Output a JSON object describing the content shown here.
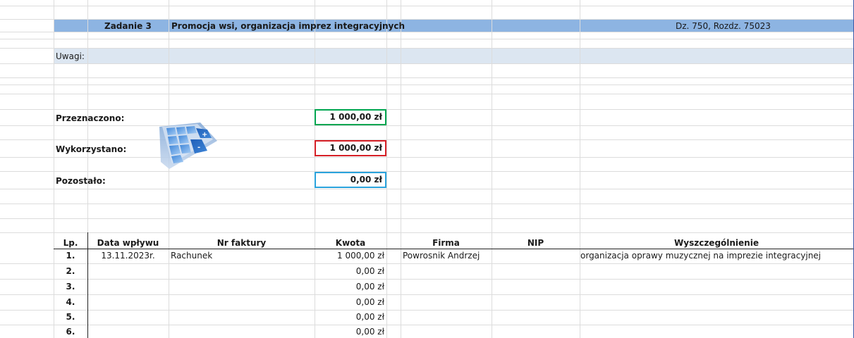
{
  "header": {
    "task_label": "Zadanie 3",
    "task_title": "Promocja wsi, organizacja imprez integracyjnych",
    "budget_code": "Dz. 750, Rozdz. 75023"
  },
  "notes": {
    "label": "Uwagi:"
  },
  "summary": {
    "allocated_label": "Przeznaczono:",
    "allocated_value": "1 000,00 zł",
    "used_label": "Wykorzystano:",
    "used_value": "1 000,00 zł",
    "remaining_label": "Pozostało:",
    "remaining_value": "0,00 zł"
  },
  "colors": {
    "header_band": "#8db4e2",
    "notes_band": "#dce6f1",
    "allocated_border": "#00a650",
    "used_border": "#d62027",
    "remaining_border": "#2aa3dc"
  },
  "icon": "calculator-icon",
  "table": {
    "headers": {
      "lp": "Lp.",
      "date": "Data wpływu",
      "invoice": "Nr faktury",
      "amount": "Kwota",
      "company": "Firma",
      "nip": "NIP",
      "details": "Wyszczególnienie"
    },
    "rows": [
      {
        "lp": "1.",
        "date": "13.11.2023r.",
        "invoice": "Rachunek",
        "amount": "1 000,00 zł",
        "company": "Powrosnik Andrzej",
        "nip": "",
        "details": "organizacja oprawy muzycznej na imprezie integracyjnej"
      },
      {
        "lp": "2.",
        "date": "",
        "invoice": "",
        "amount": "0,00 zł",
        "company": "",
        "nip": "",
        "details": ""
      },
      {
        "lp": "3.",
        "date": "",
        "invoice": "",
        "amount": "0,00 zł",
        "company": "",
        "nip": "",
        "details": ""
      },
      {
        "lp": "4.",
        "date": "",
        "invoice": "",
        "amount": "0,00 zł",
        "company": "",
        "nip": "",
        "details": ""
      },
      {
        "lp": "5.",
        "date": "",
        "invoice": "",
        "amount": "0,00 zł",
        "company": "",
        "nip": "",
        "details": ""
      },
      {
        "lp": "6.",
        "date": "",
        "invoice": "",
        "amount": "0,00 zł",
        "company": "",
        "nip": "",
        "details": ""
      }
    ]
  }
}
